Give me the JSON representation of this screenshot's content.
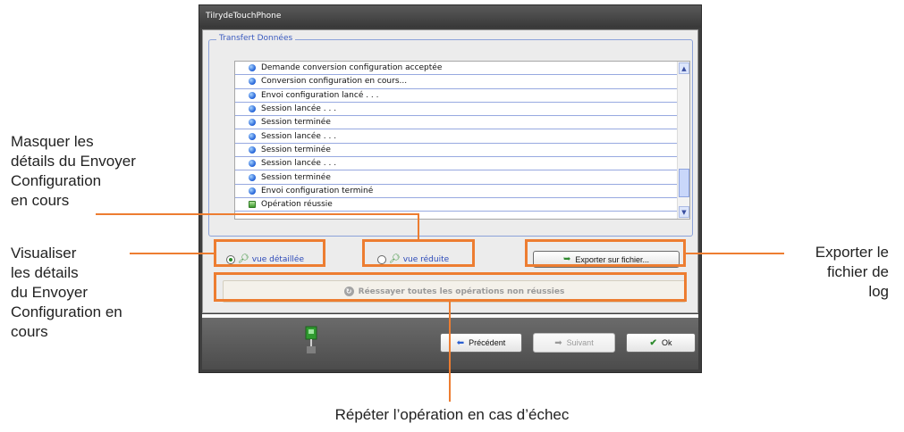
{
  "window": {
    "title": "TiIrydeTouchPhone"
  },
  "group": {
    "title": "Transfert Données"
  },
  "log": {
    "rows": [
      {
        "text": "Demande conversion configuration acceptée",
        "icon": "info-bullet-icon"
      },
      {
        "text": "Conversion configuration en cours...",
        "icon": "info-bullet-icon"
      },
      {
        "text": "Envoi configuration lancé . . .",
        "icon": "info-bullet-icon"
      },
      {
        "text": "Session lancée . . .",
        "icon": "info-bullet-icon"
      },
      {
        "text": "Session terminée",
        "icon": "info-bullet-icon"
      },
      {
        "text": "Session lancée . . .",
        "icon": "info-bullet-icon"
      },
      {
        "text": "Session terminée",
        "icon": "info-bullet-icon"
      },
      {
        "text": "Session lancée . . .",
        "icon": "info-bullet-icon"
      },
      {
        "text": "Session terminée",
        "icon": "info-bullet-icon"
      },
      {
        "text": "Envoi configuration terminé",
        "icon": "info-bullet-icon"
      },
      {
        "text": "Opération réussie",
        "icon": "success-icon"
      }
    ]
  },
  "view": {
    "detailed_label": "vue détaillée",
    "reduced_label": "vue réduite",
    "selected": "detailed"
  },
  "buttons": {
    "export": "Exporter sur fichier...",
    "retry": "Réessayer toutes les opérations non réussies",
    "previous": "Précédent",
    "next": "Suivant",
    "ok": "Ok"
  },
  "annotations": {
    "hide_details": [
      "Masquer les",
      "détails du Envoyer",
      "Configuration",
      "en cours"
    ],
    "show_details": [
      "Visualiser",
      "les détails",
      "du Envoyer",
      "Configuration en",
      "cours"
    ],
    "export_log": [
      "Exporter le",
      "fichier de",
      "log"
    ],
    "retry": "Répéter l’opération en cas d’échec"
  },
  "colors": {
    "highlight": "#ed7d31",
    "window_frame": "#3e3e3e",
    "group_title": "#3b5bbf"
  }
}
